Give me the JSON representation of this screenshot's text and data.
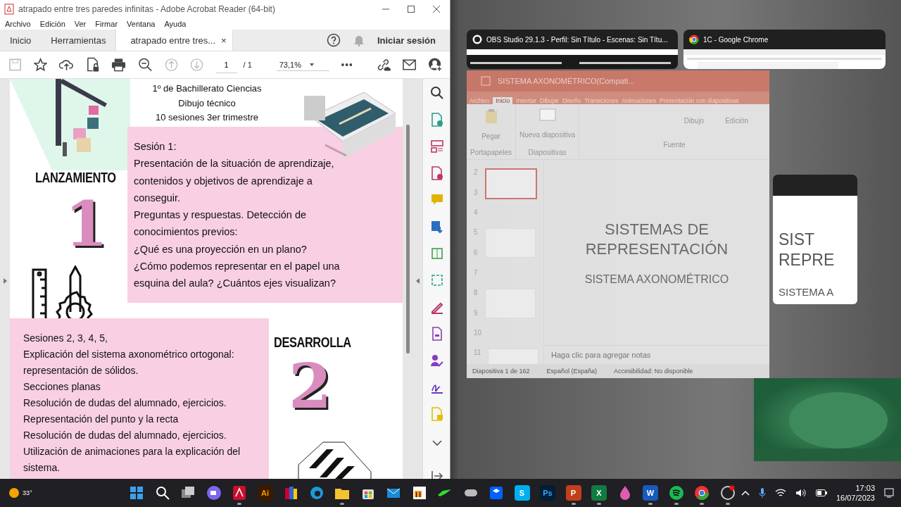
{
  "acrobat": {
    "title": "atrapado entre tres paredes infinitas - Adobe Acrobat Reader (64-bit)",
    "menu": [
      "Archivo",
      "Edición",
      "Ver",
      "Firmar",
      "Ventana",
      "Ayuda"
    ],
    "tabs": [
      {
        "label": "Inicio",
        "selected": false
      },
      {
        "label": "Herramientas",
        "selected": false
      },
      {
        "label": "atrapado entre tres...",
        "selected": true,
        "close": "×"
      }
    ],
    "sign_in": "Iniciar sesión",
    "page_field": "1",
    "page_total": "/ 1",
    "zoom": "73,1%",
    "document": {
      "header": [
        "1º de Bachillerato Ciencias",
        "Dibujo técnico",
        "10 sesiones 3er trimestre"
      ],
      "sections": [
        {
          "heading": "LANZAMIENTO",
          "number": "1",
          "paragraphs": [
            "Sesión 1:",
            "Presentación de la situación de aprendizaje, contenidos y objetivos de aprendizaje a conseguir.",
            "Preguntas y respuestas. Detección de conocimientos previos:",
            "¿Qué es una proyección en un plano?",
            "¿Cómo podemos representar en el papel una esquina del aula? ¿Cuántos ejes visualizan?"
          ]
        },
        {
          "heading": "DESARROLLA",
          "number": "2",
          "paragraphs": [
            "Sesiones 2, 3, 4, 5,",
            "Explicación del sistema axonométrico ortogonal: representación de sólidos.",
            "Secciones planas",
            "Resolución de dudas del alumnado, ejercicios.",
            "Representación del punto y la recta",
            "Resolución de dudas del alumnado, ejercicios.",
            "Utilización de animaciones para la explicación del sistema."
          ]
        }
      ]
    }
  },
  "task_view": {
    "windows": [
      {
        "title": "OBS Studio 29.1.3 - Perfil: Sin Título - Escenas: Sin Títu..."
      },
      {
        "title": "1C - Google Chrome"
      }
    ]
  },
  "powerpoint": {
    "title": "SISTEMA AXONOMÉTRICO(Compati...",
    "ribbon_tabs": [
      {
        "label": "Archivo",
        "selected": false
      },
      {
        "label": "Inicio",
        "selected": true
      },
      {
        "label": "Insertar",
        "selected": false
      },
      {
        "label": "Dibujar",
        "selected": false
      },
      {
        "label": "Diseño",
        "selected": false
      },
      {
        "label": "Transiciones",
        "selected": false
      },
      {
        "label": "Animaciones",
        "selected": false
      },
      {
        "label": "Presentación con diapositivas",
        "selected": false
      }
    ],
    "ribbon_buttons": [
      "Pegar",
      "Nueva diapositiva",
      "Dibujo",
      "Edición"
    ],
    "ribbon_groups": [
      "Portapapeles",
      "Diapositivas",
      "Fuente"
    ],
    "slide_numbers": [
      "2",
      "3",
      "4",
      "5",
      "6",
      "7",
      "8",
      "9",
      "10",
      "11"
    ],
    "slide_title": "SISTEMAS DE REPRESENTACIÓN",
    "slide_subtitle": "SISTEMA AXONOMÉTRICO",
    "notes_placeholder": "Haga clic para agregar notas",
    "status": [
      "Diapositiva 1 de 162",
      "Español (España)",
      "Accesibilidad: No disponible"
    ]
  },
  "second_window": {
    "title": "SIST",
    "title_2": "REPRE",
    "subtitle": "SISTEMA A"
  },
  "taskbar": {
    "weather": "33°",
    "apps": [
      {
        "open": false
      },
      {
        "open": false
      },
      {
        "open": false
      },
      {
        "open": false
      },
      {
        "open": true
      },
      {
        "label": "Ai",
        "open": false
      },
      {
        "open": false
      },
      {
        "open": false
      },
      {
        "open": true
      },
      {
        "open": false
      },
      {
        "open": false
      },
      {
        "open": false
      },
      {
        "open": false
      },
      {
        "open": false
      },
      {
        "open": false
      },
      {
        "label": "S",
        "open": false
      },
      {
        "label": "Ps",
        "open": false
      },
      {
        "label": "P",
        "open": true
      },
      {
        "label": "X",
        "open": true
      },
      {
        "open": false
      },
      {
        "label": "W",
        "open": true
      },
      {
        "open": true
      },
      {
        "open": true
      },
      {
        "open": true
      }
    ],
    "time": "17:03",
    "date": "16/07/2023"
  }
}
